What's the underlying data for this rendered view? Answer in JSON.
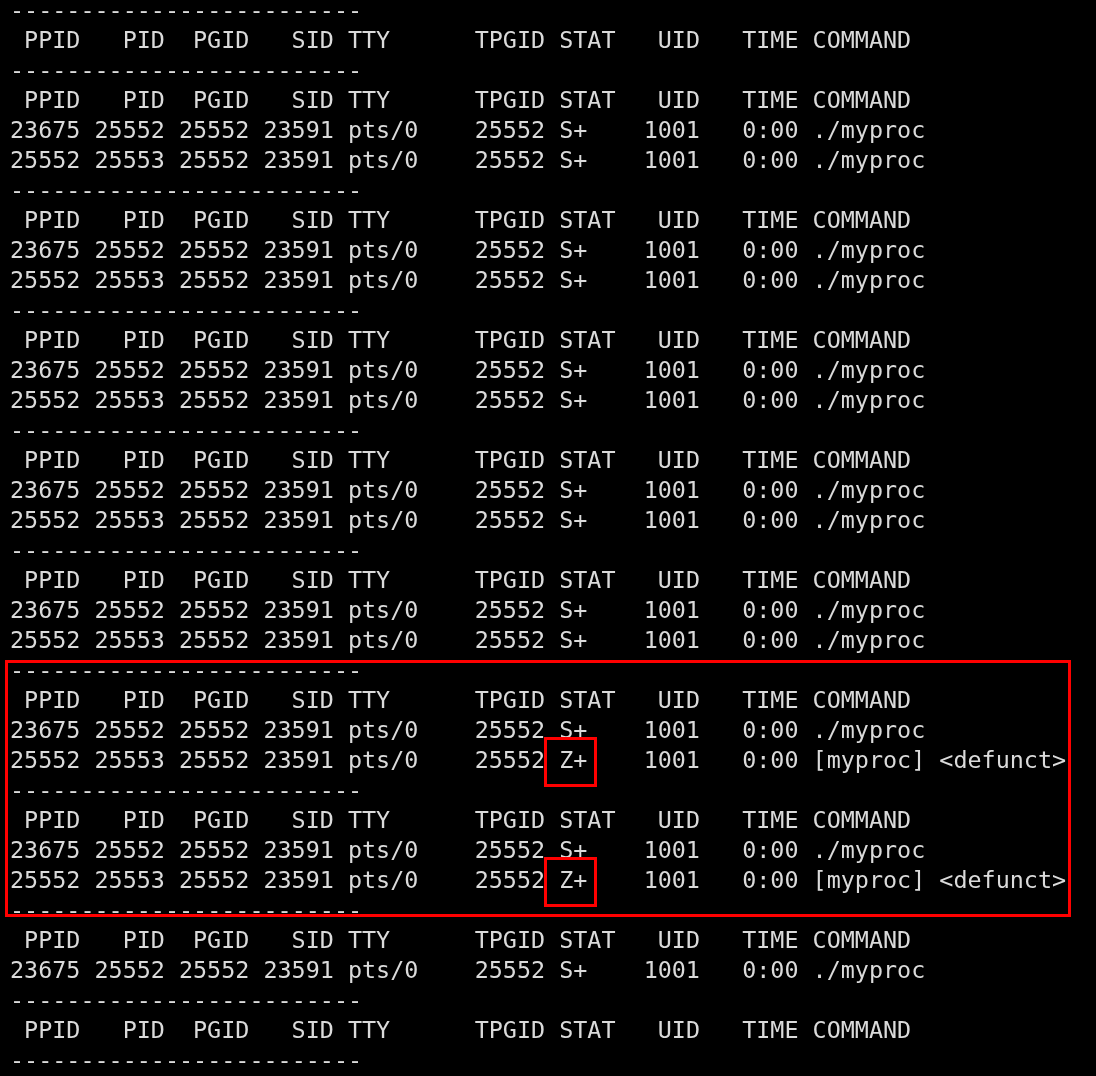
{
  "sections": [
    {
      "marked": false,
      "lines": [
        {
          "kind": "rule",
          "text": "-------------------------"
        },
        {
          "kind": "header",
          "cells": [
            "PPID",
            "PID",
            "PGID",
            "SID",
            "TTY",
            "TPGID",
            "STAT",
            "UID",
            "TIME",
            "COMMAND"
          ]
        },
        {
          "kind": "rule",
          "text": "-------------------------"
        },
        {
          "kind": "header",
          "cells": [
            "PPID",
            "PID",
            "PGID",
            "SID",
            "TTY",
            "TPGID",
            "STAT",
            "UID",
            "TIME",
            "COMMAND"
          ]
        },
        {
          "kind": "row",
          "stat_marked": false,
          "cells": [
            "23675",
            "25552",
            "25552",
            "23591",
            "pts/0",
            "25552",
            "S+",
            "1001",
            "0:00",
            "./myproc"
          ]
        },
        {
          "kind": "row",
          "stat_marked": false,
          "cells": [
            "25552",
            "25553",
            "25552",
            "23591",
            "pts/0",
            "25552",
            "S+",
            "1001",
            "0:00",
            "./myproc"
          ]
        },
        {
          "kind": "rule",
          "text": "-------------------------"
        },
        {
          "kind": "header",
          "cells": [
            "PPID",
            "PID",
            "PGID",
            "SID",
            "TTY",
            "TPGID",
            "STAT",
            "UID",
            "TIME",
            "COMMAND"
          ]
        },
        {
          "kind": "row",
          "stat_marked": false,
          "cells": [
            "23675",
            "25552",
            "25552",
            "23591",
            "pts/0",
            "25552",
            "S+",
            "1001",
            "0:00",
            "./myproc"
          ]
        },
        {
          "kind": "row",
          "stat_marked": false,
          "cells": [
            "25552",
            "25553",
            "25552",
            "23591",
            "pts/0",
            "25552",
            "S+",
            "1001",
            "0:00",
            "./myproc"
          ]
        },
        {
          "kind": "rule",
          "text": "-------------------------"
        },
        {
          "kind": "header",
          "cells": [
            "PPID",
            "PID",
            "PGID",
            "SID",
            "TTY",
            "TPGID",
            "STAT",
            "UID",
            "TIME",
            "COMMAND"
          ]
        },
        {
          "kind": "row",
          "stat_marked": false,
          "cells": [
            "23675",
            "25552",
            "25552",
            "23591",
            "pts/0",
            "25552",
            "S+",
            "1001",
            "0:00",
            "./myproc"
          ]
        },
        {
          "kind": "row",
          "stat_marked": false,
          "cells": [
            "25552",
            "25553",
            "25552",
            "23591",
            "pts/0",
            "25552",
            "S+",
            "1001",
            "0:00",
            "./myproc"
          ]
        },
        {
          "kind": "rule",
          "text": "-------------------------"
        },
        {
          "kind": "header",
          "cells": [
            "PPID",
            "PID",
            "PGID",
            "SID",
            "TTY",
            "TPGID",
            "STAT",
            "UID",
            "TIME",
            "COMMAND"
          ]
        },
        {
          "kind": "row",
          "stat_marked": false,
          "cells": [
            "23675",
            "25552",
            "25552",
            "23591",
            "pts/0",
            "25552",
            "S+",
            "1001",
            "0:00",
            "./myproc"
          ]
        },
        {
          "kind": "row",
          "stat_marked": false,
          "cells": [
            "25552",
            "25553",
            "25552",
            "23591",
            "pts/0",
            "25552",
            "S+",
            "1001",
            "0:00",
            "./myproc"
          ]
        },
        {
          "kind": "rule",
          "text": "-------------------------"
        },
        {
          "kind": "header",
          "cells": [
            "PPID",
            "PID",
            "PGID",
            "SID",
            "TTY",
            "TPGID",
            "STAT",
            "UID",
            "TIME",
            "COMMAND"
          ]
        },
        {
          "kind": "row",
          "stat_marked": false,
          "cells": [
            "23675",
            "25552",
            "25552",
            "23591",
            "pts/0",
            "25552",
            "S+",
            "1001",
            "0:00",
            "./myproc"
          ]
        },
        {
          "kind": "row",
          "stat_marked": false,
          "cells": [
            "25552",
            "25553",
            "25552",
            "23591",
            "pts/0",
            "25552",
            "S+",
            "1001",
            "0:00",
            "./myproc"
          ]
        }
      ]
    },
    {
      "marked": true,
      "lines": [
        {
          "kind": "rule",
          "text": "-------------------------"
        },
        {
          "kind": "header",
          "cells": [
            "PPID",
            "PID",
            "PGID",
            "SID",
            "TTY",
            "TPGID",
            "STAT",
            "UID",
            "TIME",
            "COMMAND"
          ]
        },
        {
          "kind": "row",
          "stat_marked": false,
          "cells": [
            "23675",
            "25552",
            "25552",
            "23591",
            "pts/0",
            "25552",
            "S+",
            "1001",
            "0:00",
            "./myproc"
          ]
        },
        {
          "kind": "row",
          "stat_marked": true,
          "cells": [
            "25552",
            "25553",
            "25552",
            "23591",
            "pts/0",
            "25552",
            "Z+",
            "1001",
            "0:00",
            "[myproc] <defunct>"
          ]
        },
        {
          "kind": "rule",
          "text": "-------------------------"
        },
        {
          "kind": "header",
          "cells": [
            "PPID",
            "PID",
            "PGID",
            "SID",
            "TTY",
            "TPGID",
            "STAT",
            "UID",
            "TIME",
            "COMMAND"
          ]
        },
        {
          "kind": "row",
          "stat_marked": false,
          "cells": [
            "23675",
            "25552",
            "25552",
            "23591",
            "pts/0",
            "25552",
            "S+",
            "1001",
            "0:00",
            "./myproc"
          ]
        },
        {
          "kind": "row",
          "stat_marked": true,
          "cells": [
            "25552",
            "25553",
            "25552",
            "23591",
            "pts/0",
            "25552",
            "Z+",
            "1001",
            "0:00",
            "[myproc] <defunct>"
          ]
        },
        {
          "kind": "rule",
          "text": "-------------------------"
        }
      ]
    },
    {
      "marked": false,
      "lines": [
        {
          "kind": "header",
          "cells": [
            "PPID",
            "PID",
            "PGID",
            "SID",
            "TTY",
            "TPGID",
            "STAT",
            "UID",
            "TIME",
            "COMMAND"
          ]
        },
        {
          "kind": "row",
          "stat_marked": false,
          "cells": [
            "23675",
            "25552",
            "25552",
            "23591",
            "pts/0",
            "25552",
            "S+",
            "1001",
            "0:00",
            "./myproc"
          ]
        },
        {
          "kind": "rule",
          "text": "-------------------------"
        },
        {
          "kind": "header",
          "cells": [
            "PPID",
            "PID",
            "PGID",
            "SID",
            "TTY",
            "TPGID",
            "STAT",
            "UID",
            "TIME",
            "COMMAND"
          ]
        },
        {
          "kind": "rule",
          "text": "-------------------------"
        }
      ]
    }
  ]
}
